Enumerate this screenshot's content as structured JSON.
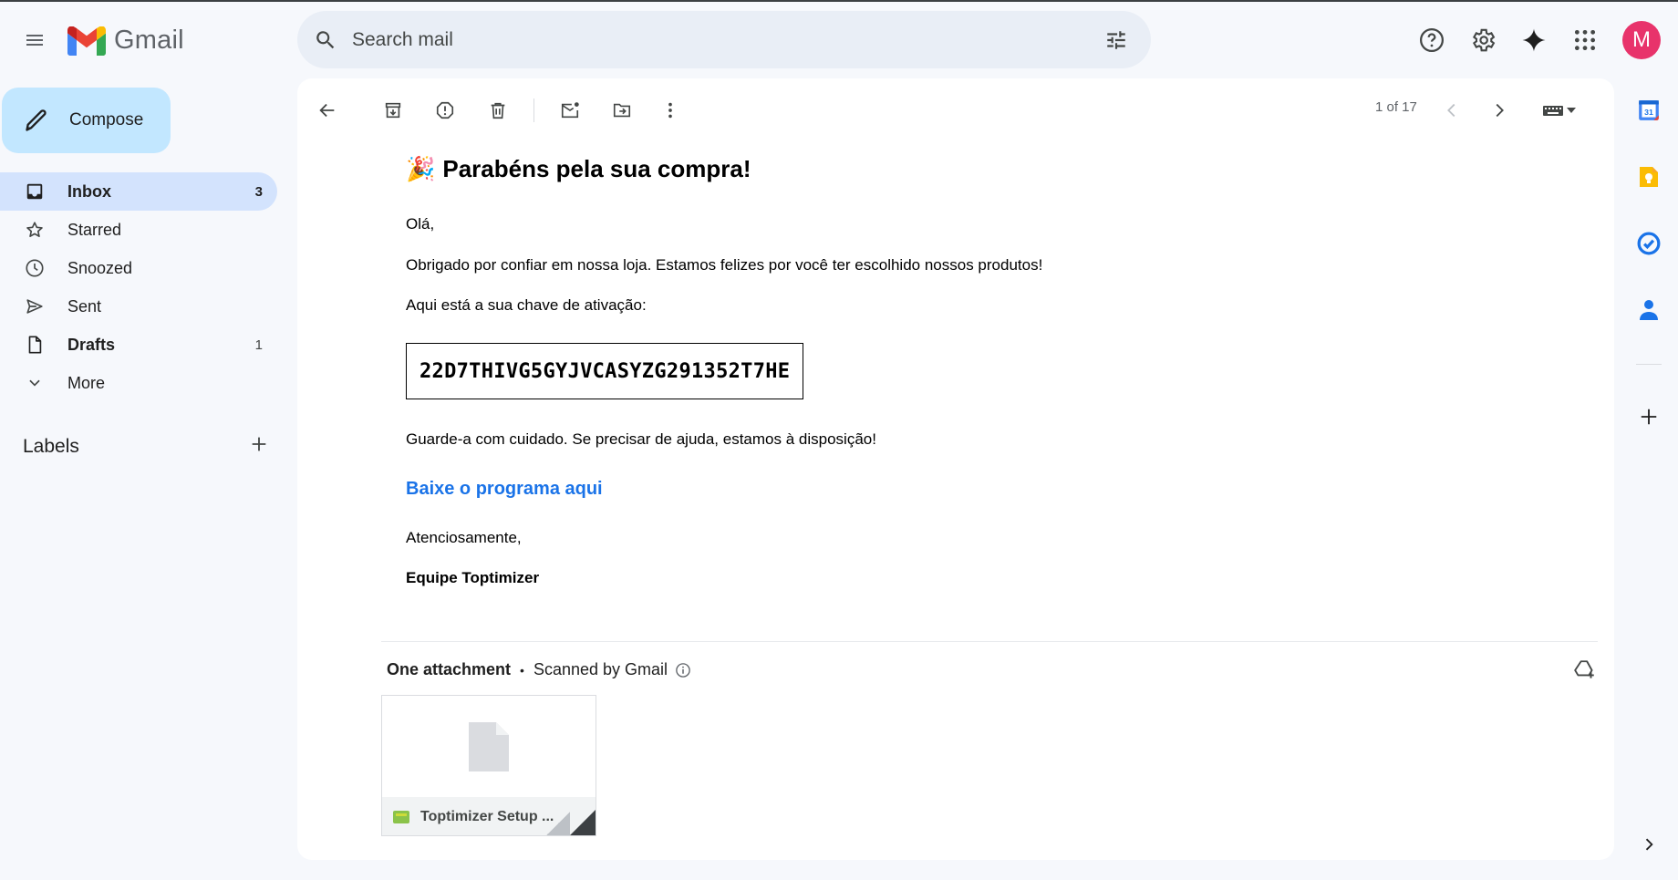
{
  "app": {
    "name": "Gmail"
  },
  "search": {
    "placeholder": "Search mail"
  },
  "compose": {
    "label": "Compose"
  },
  "nav": {
    "items": [
      {
        "label": "Inbox",
        "count": "3"
      },
      {
        "label": "Starred",
        "count": ""
      },
      {
        "label": "Snoozed",
        "count": ""
      },
      {
        "label": "Sent",
        "count": ""
      },
      {
        "label": "Drafts",
        "count": "1"
      },
      {
        "label": "More",
        "count": ""
      }
    ],
    "labels_title": "Labels"
  },
  "user": {
    "avatar_letter": "M",
    "avatar_color": "#e8336b"
  },
  "toolbar": {
    "pager": "1 of 17"
  },
  "email": {
    "subject_emoji": "🎉",
    "subject": "Parabéns pela sua compra!",
    "greeting": "Olá,",
    "line1": "Obrigado por confiar em nossa loja. Estamos felizes por você ter escolhido nossos produtos!",
    "line2": "Aqui está a sua chave de ativação:",
    "activation_key": "22D7THIVG5GYJVCASYZG291352T7HE",
    "line3": "Guarde-a com cuidado. Se precisar de ajuda, estamos à disposição!",
    "download_link": "Baixe o programa aqui",
    "closing": "Atenciosamente,",
    "signature": "Equipe Toptimizer"
  },
  "attachments": {
    "header": "One attachment",
    "scanned": "Scanned by Gmail",
    "file_name": "Toptimizer Setup ..."
  },
  "colors": {
    "accent": "#1a73e8",
    "compose_bg": "#c2e7ff",
    "active_nav_bg": "#d3e3fd",
    "page_bg": "#f6f8fc"
  }
}
